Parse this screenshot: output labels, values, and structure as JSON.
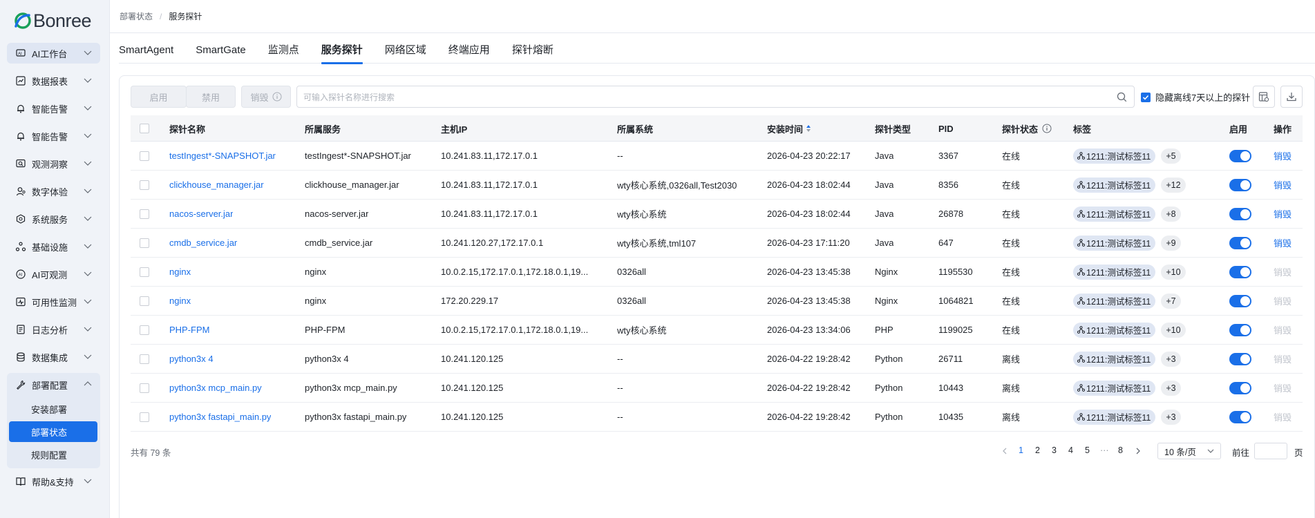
{
  "brand": {
    "name": "Bonree",
    "accent": "#1a6fe8"
  },
  "sidebar": {
    "items": [
      {
        "label": "AI工作台",
        "icon": "ai-workbench-icon"
      },
      {
        "label": "数据报表",
        "icon": "chart-icon"
      },
      {
        "label": "智能告警",
        "icon": "alarm-icon"
      },
      {
        "label": "智能告警",
        "icon": "alarm-icon"
      },
      {
        "label": "观测洞察",
        "icon": "insight-icon"
      },
      {
        "label": "数字体验",
        "icon": "user-experience-icon"
      },
      {
        "label": "系统服务",
        "icon": "system-service-icon"
      },
      {
        "label": "基础设施",
        "icon": "infrastructure-icon"
      },
      {
        "label": "AI可观测",
        "icon": "ai-observe-icon"
      },
      {
        "label": "可用性监测",
        "icon": "availability-icon"
      },
      {
        "label": "日志分析",
        "icon": "log-icon"
      },
      {
        "label": "数据集成",
        "icon": "data-integration-icon"
      },
      {
        "label": "部署配置",
        "icon": "wrench-icon"
      },
      {
        "label": "帮助&支持",
        "icon": "book-icon"
      }
    ],
    "sub_items": [
      {
        "label": "安装部署"
      },
      {
        "label": "部署状态"
      },
      {
        "label": "规则配置"
      }
    ]
  },
  "breadcrumb": {
    "parent": "部署状态",
    "current": "服务探针",
    "separator": "/"
  },
  "tabs": [
    "SmartAgent",
    "SmartGate",
    "监测点",
    "服务探针",
    "网络区域",
    "终端应用",
    "探针熔断"
  ],
  "toolbar": {
    "enable": "启用",
    "disable": "禁用",
    "destroy": "销毁",
    "search_placeholder": "可输入探针名称进行搜索",
    "hide_offline": "隐藏离线7天以上的探针"
  },
  "table": {
    "columns": [
      "探针名称",
      "所属服务",
      "主机IP",
      "所属系统",
      "安装时间",
      "探针类型",
      "PID",
      "探针状态",
      "标签",
      "启用",
      "操作"
    ],
    "rows": [
      {
        "name": "testIngest*-SNAPSHOT.jar",
        "service": "testIngest*-SNAPSHOT.jar",
        "ip": "10.241.83.11,172.17.0.1",
        "system": "--",
        "time": "2026-04-23 20:22:17",
        "type": "Java",
        "pid": "3367",
        "status": "在线",
        "tag": "1211:测试标签11",
        "more": "+5",
        "op": "销毁",
        "op_active": true
      },
      {
        "name": "clickhouse_manager.jar",
        "service": "clickhouse_manager.jar",
        "ip": "10.241.83.11,172.17.0.1",
        "system": "wty核心系统,0326all,Test2030",
        "time": "2026-04-23 18:02:44",
        "type": "Java",
        "pid": "8356",
        "status": "在线",
        "tag": "1211:测试标签11",
        "more": "+12",
        "op": "销毁",
        "op_active": true
      },
      {
        "name": "nacos-server.jar",
        "service": "nacos-server.jar",
        "ip": "10.241.83.11,172.17.0.1",
        "system": "wty核心系统",
        "time": "2026-04-23 18:02:44",
        "type": "Java",
        "pid": "26878",
        "status": "在线",
        "tag": "1211:测试标签11",
        "more": "+8",
        "op": "销毁",
        "op_active": true
      },
      {
        "name": "cmdb_service.jar",
        "service": "cmdb_service.jar",
        "ip": "10.241.120.27,172.17.0.1",
        "system": "wty核心系统,tml107",
        "time": "2026-04-23 17:11:20",
        "type": "Java",
        "pid": "647",
        "status": "在线",
        "tag": "1211:测试标签11",
        "more": "+9",
        "op": "销毁",
        "op_active": true
      },
      {
        "name": "nginx",
        "service": "nginx",
        "ip": "10.0.2.15,172.17.0.1,172.18.0.1,19...",
        "system": "0326all",
        "time": "2026-04-23 13:45:38",
        "type": "Nginx",
        "pid": "1195530",
        "status": "在线",
        "tag": "1211:测试标签11",
        "more": "+10",
        "op": "销毁",
        "op_active": false
      },
      {
        "name": "nginx",
        "service": "nginx",
        "ip": "172.20.229.17",
        "system": "0326all",
        "time": "2026-04-23 13:45:38",
        "type": "Nginx",
        "pid": "1064821",
        "status": "在线",
        "tag": "1211:测试标签11",
        "more": "+7",
        "op": "销毁",
        "op_active": false
      },
      {
        "name": "PHP-FPM",
        "service": "PHP-FPM",
        "ip": "10.0.2.15,172.17.0.1,172.18.0.1,19...",
        "system": "wty核心系统",
        "time": "2026-04-23 13:34:06",
        "type": "PHP",
        "pid": "1199025",
        "status": "在线",
        "tag": "1211:测试标签11",
        "more": "+10",
        "op": "销毁",
        "op_active": false
      },
      {
        "name": "python3x 4",
        "service": "python3x 4",
        "ip": "10.241.120.125",
        "system": "--",
        "time": "2026-04-22 19:28:42",
        "type": "Python",
        "pid": "26711",
        "status": "离线",
        "tag": "1211:测试标签11",
        "more": "+3",
        "op": "销毁",
        "op_active": false
      },
      {
        "name": "python3x mcp_main.py",
        "service": "python3x mcp_main.py",
        "ip": "10.241.120.125",
        "system": "--",
        "time": "2026-04-22 19:28:42",
        "type": "Python",
        "pid": "10443",
        "status": "离线",
        "tag": "1211:测试标签11",
        "more": "+3",
        "op": "销毁",
        "op_active": false
      },
      {
        "name": "python3x fastapi_main.py",
        "service": "python3x fastapi_main.py",
        "ip": "10.241.120.125",
        "system": "--",
        "time": "2026-04-22 19:28:42",
        "type": "Python",
        "pid": "10435",
        "status": "离线",
        "tag": "1211:测试标签11",
        "more": "+3",
        "op": "销毁",
        "op_active": false
      }
    ]
  },
  "footer": {
    "total": "共有 79 条",
    "pages": [
      "1",
      "2",
      "3",
      "4",
      "5",
      "···",
      "8"
    ],
    "current_page": "1",
    "page_size": "10 条/页",
    "goto_label": "前往",
    "page_unit": "页"
  }
}
